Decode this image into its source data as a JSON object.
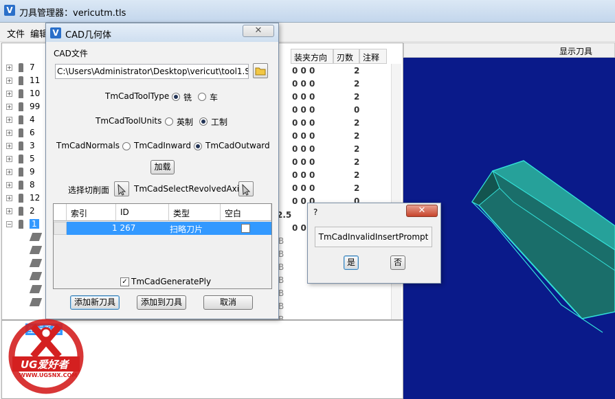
{
  "app": {
    "icon_letter": "V",
    "title": "刀具管理器：vericutm.tls"
  },
  "menu": {
    "file": "文件",
    "edit": "编辑"
  },
  "tree": {
    "items": [
      "7",
      "11",
      "10",
      "99",
      "4",
      "6",
      "3",
      "5",
      "9",
      "8",
      "12",
      "2",
      "1"
    ],
    "selected": "1",
    "selected_expand": "−"
  },
  "grid": {
    "headers": [
      "装夹方向",
      "刃数",
      "注释"
    ],
    "rows": [
      {
        "dir": "0 0 0",
        "flutes": "2"
      },
      {
        "dir": "0 0 0",
        "flutes": "2"
      },
      {
        "dir": "0 0 0",
        "flutes": "2"
      },
      {
        "dir": "0 0 0",
        "flutes": "0"
      },
      {
        "dir": "0 0 0",
        "flutes": "2"
      },
      {
        "dir": "0 0 0",
        "flutes": "2"
      },
      {
        "dir": "0 0 0",
        "flutes": "2"
      },
      {
        "dir": "0 0 0",
        "flutes": "2"
      },
      {
        "dir": "0 0 0",
        "flutes": "2"
      },
      {
        "dir": "0 0 0",
        "flutes": "2"
      },
      {
        "dir": "0 0 0",
        "flutes": "0"
      }
    ],
    "partial_left": "2.5",
    "partial_dir": "0 0 0",
    "b_cells": [
      "B",
      "B",
      "B",
      "B",
      "B",
      "B",
      "B"
    ]
  },
  "right_header": {
    "display_tool": "显示刀具"
  },
  "bottom": {
    "coord_label": "坐标系统"
  },
  "cad_dialog": {
    "icon_letter": "V",
    "title": "CAD几何体",
    "close": "✕",
    "file_label": "CAD文件",
    "file_path": "C:\\Users\\Administrator\\Desktop\\vericut\\tool1.STEP",
    "tool_type_label": "TmCadToolType",
    "tool_type_options": [
      "铣",
      "车"
    ],
    "tool_type_selected": "铣",
    "units_label": "TmCadToolUnits",
    "units_options": [
      "英制",
      "工制"
    ],
    "units_selected": "工制",
    "normals_label": "TmCadNormals",
    "normals_options": [
      "TmCadInward",
      "TmCadOutward"
    ],
    "normals_selected": "TmCadOutward",
    "load_button": "加载",
    "pick_cut_label": "选择切削面",
    "revolved_axis_label": "TmCadSelectRevolvedAxis",
    "table": {
      "headers": [
        "索引",
        "ID",
        "类型",
        "空白"
      ],
      "rows": [
        {
          "index": "",
          "id": "1 267",
          "type": "扫略刀片",
          "blank": false
        }
      ]
    },
    "generate_ply_label": "TmCadGeneratePly",
    "generate_ply_checked": true,
    "add_new_tool": "添加新刀具",
    "add_to_tool": "添加到刀具",
    "cancel": "取消"
  },
  "question_dialog": {
    "title": "?",
    "close": "✕",
    "prompt": "TmCadInvalidInsertPrompt",
    "yes": "是",
    "no": "否"
  },
  "watermark": {
    "brand": "UG爱好者",
    "url": "WWW.UGSNX.COM"
  },
  "colors": {
    "viewport_bg": "#0a1a8a",
    "tool_cyan": "#33e0d8",
    "selection": "#3399ff"
  }
}
